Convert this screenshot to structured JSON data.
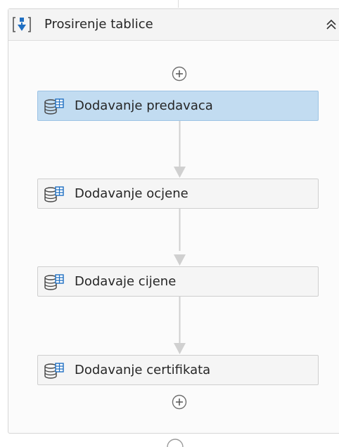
{
  "sequence": {
    "title": "Prosirenje tablice",
    "icon": "sequence-icon",
    "collapse_icon": "double-chevron-up-icon",
    "add_icon": "plus-circle-icon",
    "activities": [
      {
        "label": "Dodavanje predavaca",
        "selected": true,
        "icon": "database-table-icon"
      },
      {
        "label": "Dodavanje ocjene",
        "selected": false,
        "icon": "database-table-icon"
      },
      {
        "label": "Dodavaje cijene",
        "selected": false,
        "icon": "database-table-icon"
      },
      {
        "label": "Dodavanje certifikata",
        "selected": false,
        "icon": "database-table-icon"
      }
    ]
  },
  "colors": {
    "selected_bg": "#c2dcf1",
    "activity_bg": "#f5f5f5",
    "connector": "#d0d0d0",
    "icon_blue": "#1f6fc2"
  }
}
